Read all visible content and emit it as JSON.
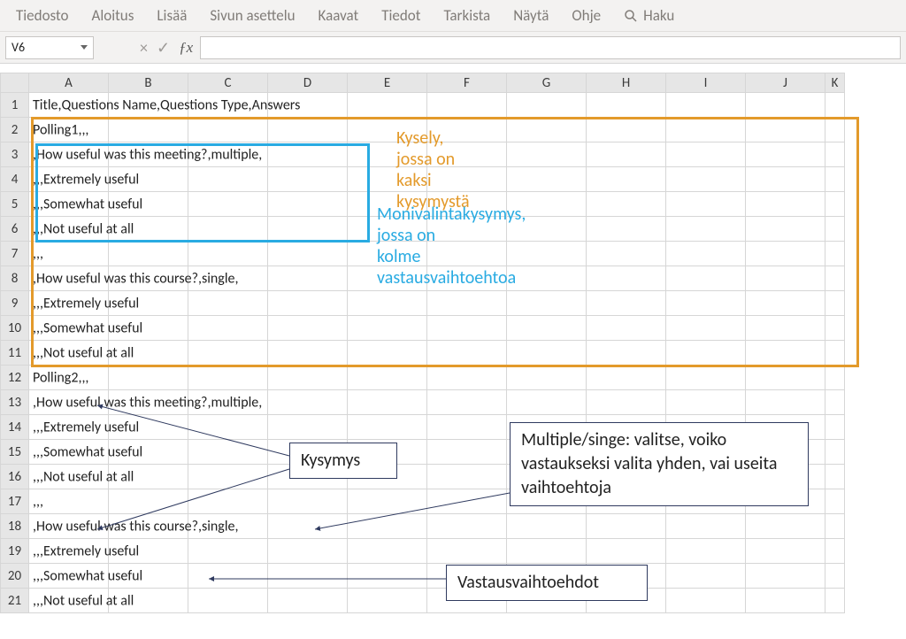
{
  "ribbon": {
    "tabs": [
      "Tiedosto",
      "Aloitus",
      "Lisää",
      "Sivun asettelu",
      "Kaavat",
      "Tiedot",
      "Tarkista",
      "Näytä",
      "Ohje"
    ],
    "search_label": "Haku"
  },
  "namebox": {
    "value": "V6"
  },
  "formula_bar": {
    "value": ""
  },
  "columns": [
    "A",
    "B",
    "C",
    "D",
    "E",
    "F",
    "G",
    "H",
    "I",
    "J",
    "K"
  ],
  "rows": [
    {
      "n": 1,
      "a": "Title,Questions Name,Questions Type,Answers"
    },
    {
      "n": 2,
      "a": "Polling1,,,"
    },
    {
      "n": 3,
      "a": ",How useful was this meeting?,multiple,"
    },
    {
      "n": 4,
      "a": ",,,Extremely useful"
    },
    {
      "n": 5,
      "a": ",,,Somewhat useful"
    },
    {
      "n": 6,
      "a": ",,,Not useful at all"
    },
    {
      "n": 7,
      "a": ",,,"
    },
    {
      "n": 8,
      "a": ",How useful was this course?,single,"
    },
    {
      "n": 9,
      "a": ",,,Extremely useful"
    },
    {
      "n": 10,
      "a": ",,,Somewhat useful"
    },
    {
      "n": 11,
      "a": ",,,Not useful at all"
    },
    {
      "n": 12,
      "a": "Polling2,,,"
    },
    {
      "n": 13,
      "a": ",How useful was this meeting?,multiple,"
    },
    {
      "n": 14,
      "a": ",,,Extremely useful"
    },
    {
      "n": 15,
      "a": ",,,Somewhat useful"
    },
    {
      "n": 16,
      "a": ",,,Not useful at all"
    },
    {
      "n": 17,
      "a": ",,,"
    },
    {
      "n": 18,
      "a": ",How useful was this course?,single,"
    },
    {
      "n": 19,
      "a": ",,,Extremely useful"
    },
    {
      "n": 20,
      "a": ",,,Somewhat useful"
    },
    {
      "n": 21,
      "a": ",,,Not useful at all"
    }
  ],
  "annotations": {
    "orange_text": "Kysely, jossa on kaksi kysymystä",
    "blue_text_line1": "Monivalintakysymys, jossa on",
    "blue_text_line2": "kolme vastausvaihtoehtoa",
    "box_kysymys": "Kysymys",
    "box_multiple": "Multiple/singe: valitse, voiko vastaukseksi valita yhden, vai useita vaihtoehtoja",
    "box_vastaus": "Vastausvaihtoehdot"
  },
  "colors": {
    "orange": "#E39A2B",
    "blue": "#29ABE2",
    "darknavy": "#2F3A5F"
  }
}
